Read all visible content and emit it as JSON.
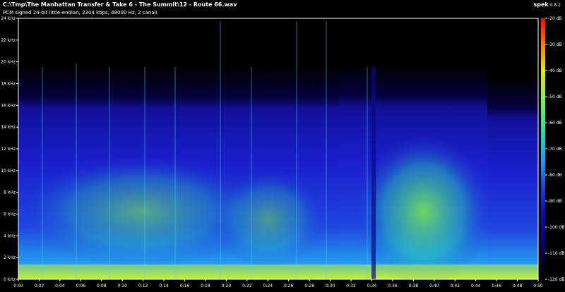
{
  "header": {
    "file_path": "C:\\Tmp\\The Manhattan Transfer & Take 6 - The Summit\\12 - Route 66.wav",
    "stream_info": "PCM signed 24-bit little-endian, 2304 kbps, 48000 Hz, 2 canali",
    "app_name": "spek",
    "app_version": "0.8.2"
  },
  "spectrogram": {
    "freq_ticks": [
      "0 kHz",
      "2 kHz",
      "4 kHz",
      "6 kHz",
      "8 kHz",
      "10 kHz",
      "12 kHz",
      "14 kHz",
      "16 kHz",
      "18 kHz",
      "20 kHz",
      "22 kHz",
      "24 kHz"
    ],
    "time_ticks": [
      "0:00",
      "0:02",
      "0:04",
      "0:06",
      "0:08",
      "0:10",
      "0:12",
      "0:14",
      "0:16",
      "0:18",
      "0:20",
      "0:22",
      "0:24",
      "0:26",
      "0:28",
      "0:30",
      "0:32",
      "0:34",
      "0:36",
      "0:38",
      "0:40",
      "0:42",
      "0:44",
      "0:46",
      "0:48",
      "0:50"
    ],
    "colormap": [
      "#000000",
      "#06006a",
      "#1a17c7",
      "#0c7ff2",
      "#35e0c6",
      "#86f04a",
      "#e6f01c",
      "#f5a000",
      "#f01c1c",
      "#ff3030"
    ]
  },
  "legend": {
    "db_ticks": [
      "-20 dB",
      "-30 dB",
      "-40 dB",
      "-50 dB",
      "-60 dB",
      "-70 dB",
      "-80 dB",
      "-90 dB",
      "-100 dB",
      "-110 dB",
      "-120 dB"
    ],
    "colors": [
      "#ff0000",
      "#ff7a00",
      "#e6e619",
      "#73f25c",
      "#21d6b3",
      "#1a9bf5",
      "#1740e0",
      "#0c0ab0",
      "#050078",
      "#020030",
      "#000000"
    ]
  }
}
